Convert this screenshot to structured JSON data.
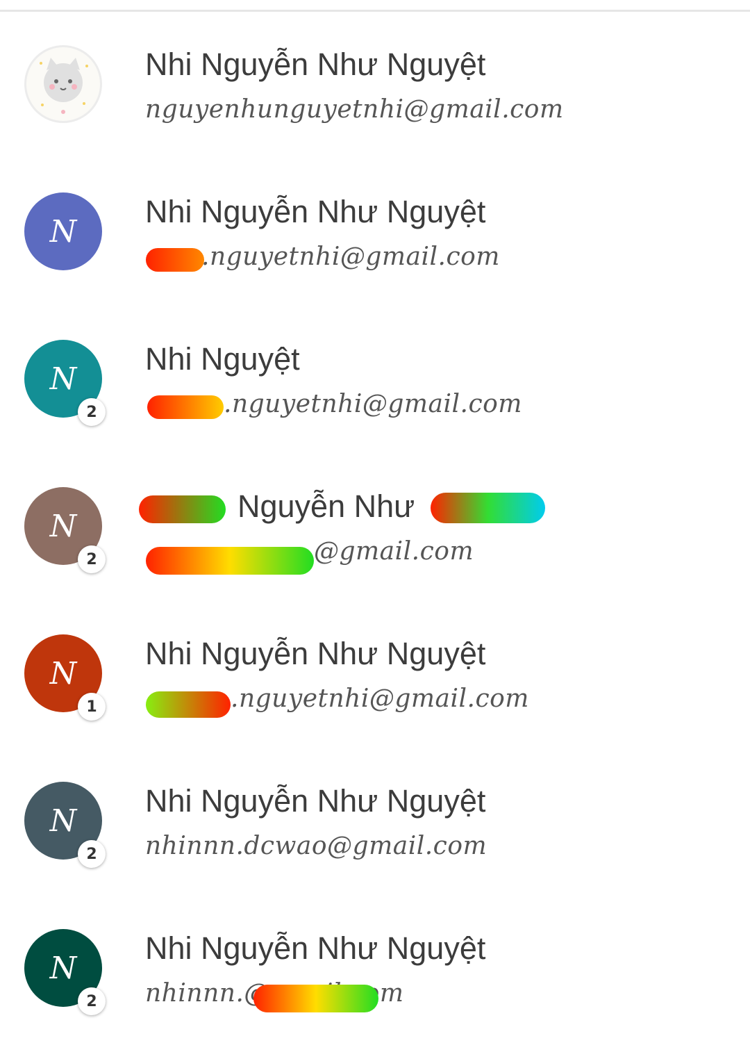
{
  "accounts": [
    {
      "name": "Nhi Nguyễn Như Nguyệt",
      "email": "nguyenhunguyetnhi@gmail.com",
      "avatar_letter": "",
      "avatar_type": "photo-cat-icon",
      "avatar_color": "#fbfaf6",
      "badge": ""
    },
    {
      "name": "Nhi Nguyễn Như Nguyệt",
      "email": ".nguyetnhi@gmail.com",
      "avatar_letter": "N",
      "avatar_color": "#5c6bc0",
      "badge": ""
    },
    {
      "name": "Nhi Nguyệt",
      "email": ".nguyetnhi@gmail.com",
      "avatar_letter": "N",
      "avatar_color": "#138f95",
      "badge": "2"
    },
    {
      "name": "Nguyễn Như",
      "email": "@gmail.com",
      "avatar_letter": "N",
      "avatar_color": "#8d6e63",
      "badge": "2"
    },
    {
      "name": "Nhi Nguyễn Như Nguyệt",
      "email": ".nguyetnhi@gmail.com",
      "avatar_letter": "N",
      "avatar_color": "#bf360c",
      "badge": "1"
    },
    {
      "name": "Nhi Nguyễn Như Nguyệt",
      "email": "nhinnn.dcwao@gmail.com",
      "avatar_letter": "N",
      "avatar_color": "#455a64",
      "badge": "2"
    },
    {
      "name": "Nhi Nguyễn Như Nguyệt",
      "email": "nhinnn.@gmail.com",
      "avatar_letter": "N",
      "avatar_color": "#004d40",
      "badge": "2"
    }
  ]
}
